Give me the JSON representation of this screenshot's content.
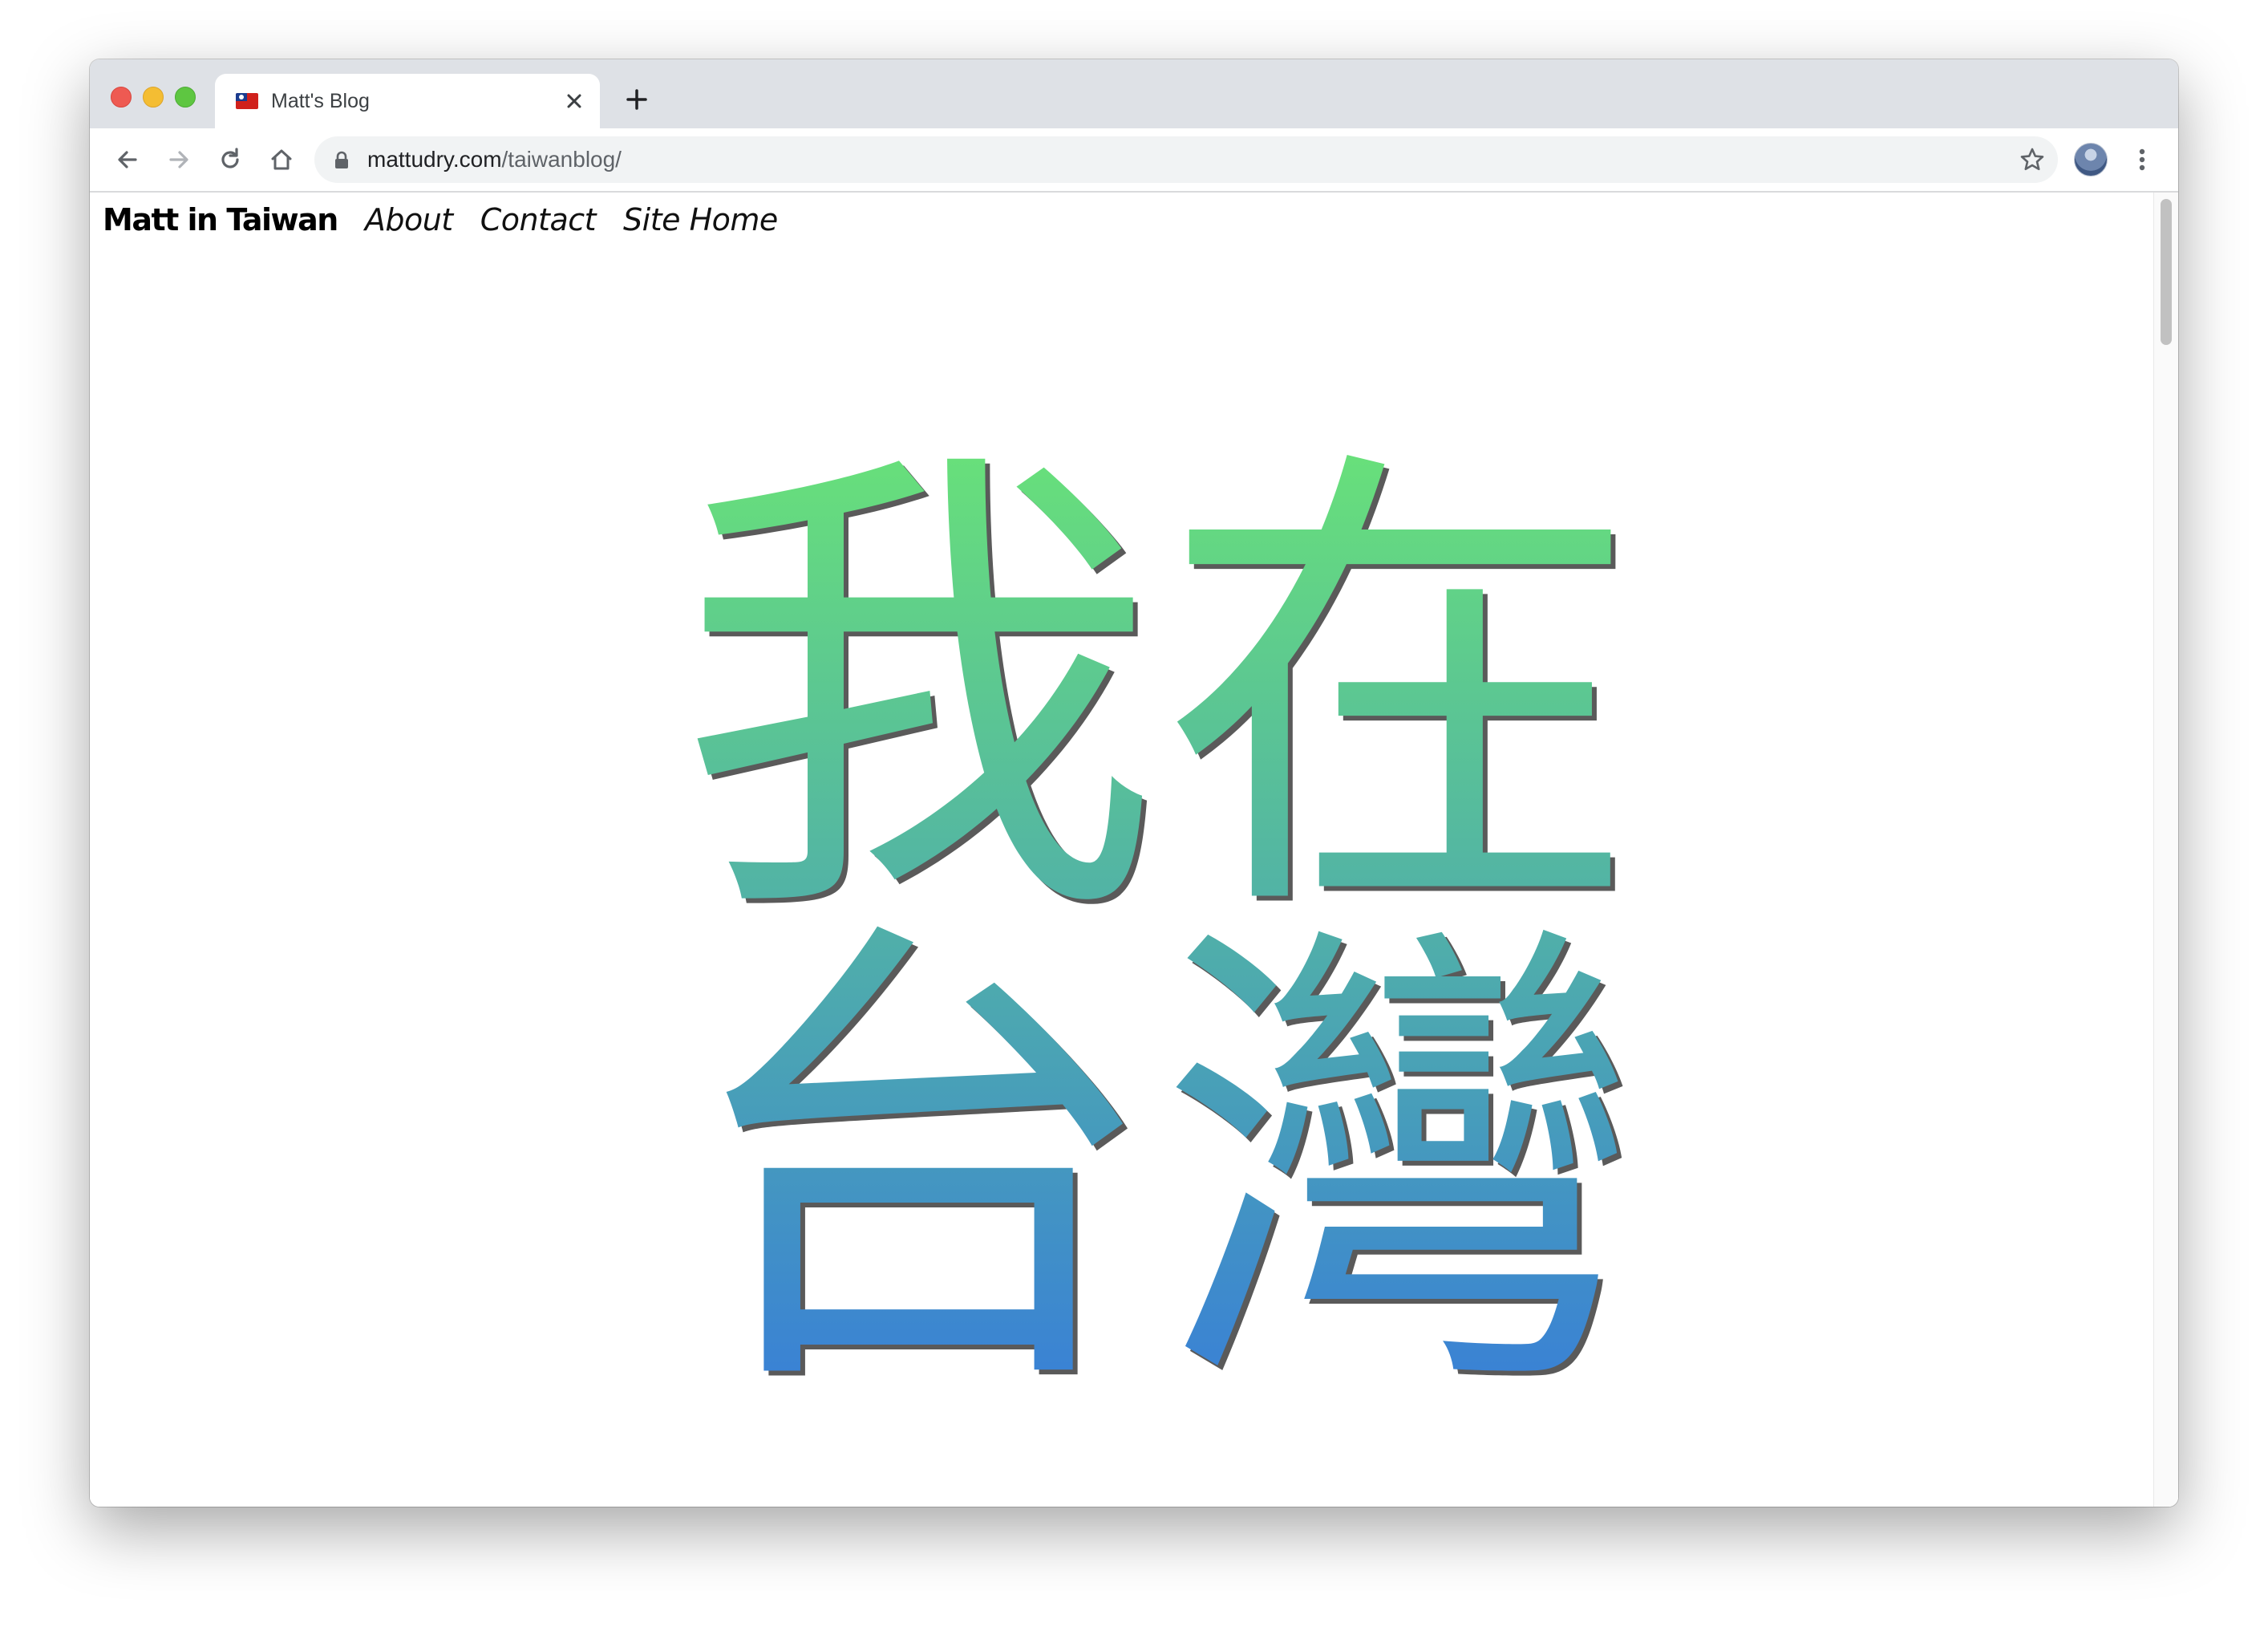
{
  "browser": {
    "tab": {
      "title": "Matt's Blog",
      "favicon": "taiwan-flag-icon"
    },
    "address_bar": {
      "domain": "mattudry.com",
      "path": "/taiwanblog/"
    }
  },
  "site": {
    "brand": "Matt in Taiwan",
    "nav": [
      {
        "label": "About"
      },
      {
        "label": "Contact"
      },
      {
        "label": "Site Home"
      }
    ]
  },
  "hero": {
    "line1": "我在",
    "line2": "台灣",
    "gradient_top": "#68e07a",
    "gradient_bottom": "#3476e0",
    "shadow_color": "#5a5a5a"
  },
  "colors": {
    "tab_strip": "#dee1e6",
    "omnibox": "#f1f3f4",
    "close_red": "#ee5a52",
    "minimize_yellow": "#f4bd33",
    "zoom_green": "#5ec641"
  }
}
